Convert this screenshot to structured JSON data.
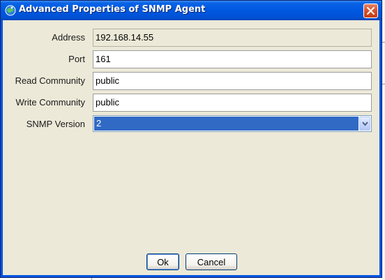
{
  "window": {
    "title": "Advanced Properties of SNMP Agent",
    "close_icon": "close-icon",
    "app_icon": "globe-icon"
  },
  "form": {
    "address": {
      "label": "Address",
      "value": "192.168.14.55",
      "readonly": true
    },
    "port": {
      "label": "Port",
      "value": "161"
    },
    "read_community": {
      "label": "Read Community",
      "value": "public"
    },
    "write_community": {
      "label": "Write Community",
      "value": "public"
    },
    "snmp_version": {
      "label": "SNMP Version",
      "selected": "2"
    }
  },
  "buttons": {
    "ok": "Ok",
    "cancel": "Cancel"
  },
  "colors": {
    "titlebar": "#0054e3",
    "client_bg": "#ece9d8",
    "selection": "#316ac5"
  }
}
